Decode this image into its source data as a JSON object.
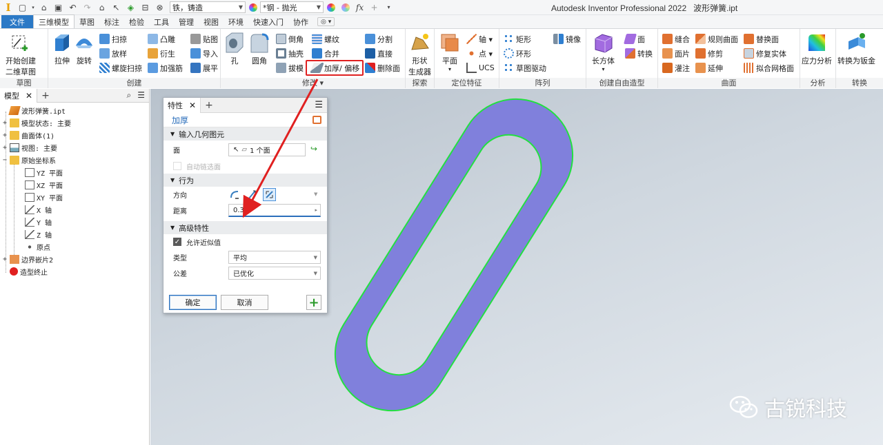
{
  "app": {
    "title": "Autodesk Inventor Professional 2022",
    "filename": "波形弹簧.ipt",
    "logo": "I",
    "material": "铁，铸造",
    "appearance": "*钢 - 抛光",
    "fx": "fx"
  },
  "tabs": [
    "文件",
    "三维模型",
    "草图",
    "标注",
    "检验",
    "工具",
    "管理",
    "视图",
    "环境",
    "快速入门",
    "协作"
  ],
  "tabs_extra": "◎ ▾",
  "ribbon": {
    "sketch_panel": {
      "label": "草图",
      "start_sketch": "开始创建",
      "start_sketch2": "二维草图"
    },
    "create_panel": {
      "label": "创建",
      "extrude": "拉伸",
      "revolve": "旋转",
      "sweep": "扫掠",
      "loft": "放样",
      "coil": "螺旋扫掠",
      "emboss": "凸雕",
      "derive": "衍生",
      "rib": "加强筋",
      "decal": "贴图",
      "import": "导入",
      "unwrap": "展平"
    },
    "modify_panel": {
      "label": "修改 ▾",
      "hole": "孔",
      "fillet": "圆角",
      "chamfer": "倒角",
      "shell": "抽壳",
      "draft": "拔模",
      "thread": "螺纹",
      "combine": "合并",
      "thicken": "加厚/ 偏移",
      "split": "分割",
      "direct": "直接",
      "delete_face": "删除面"
    },
    "explore_panel": {
      "label": "探索",
      "shape_gen": "形状",
      "shape_gen2": "生成器"
    },
    "workfeat_panel": {
      "label": "定位特征",
      "plane": "平面",
      "axis": "轴 ▾",
      "point": "点 ▾",
      "ucs": "UCS"
    },
    "pattern_panel": {
      "label": "阵列",
      "rect": "矩形",
      "circ": "环形",
      "sketch_driven": "草图驱动",
      "mirror": "镜像"
    },
    "freeform_panel": {
      "label": "创建自由造型",
      "box": "长方体",
      "face": "面",
      "convert": "转换"
    },
    "surface_panel": {
      "label": "曲面",
      "stitch": "缝合",
      "patch": "面片",
      "sculpt": "灌注",
      "ruled": "规则曲面",
      "trim": "修剪",
      "extend": "延伸",
      "replace": "替换面",
      "repair": "修复实体",
      "fit_mesh": "拟合网格面"
    },
    "analysis_panel": {
      "label": "分析",
      "stress": "应力分析"
    },
    "convert_panel": {
      "label": "转换",
      "to_sheet": "转换为钣金"
    }
  },
  "browser": {
    "tab": "模型",
    "nodes": [
      {
        "label": "波形弹簧.ipt",
        "level": 0,
        "toggle": "",
        "icon": "part-icon"
      },
      {
        "label": "模型状态: 主要",
        "level": 0,
        "toggle": "+",
        "icon": "folder-icon"
      },
      {
        "label": "曲面体(1)",
        "level": 0,
        "toggle": "+",
        "icon": "folder-icon"
      },
      {
        "label": "视图: 主要",
        "level": 0,
        "toggle": "+",
        "icon": "view-icon"
      },
      {
        "label": "原始坐标系",
        "level": 0,
        "toggle": "−",
        "icon": "folder-icon"
      },
      {
        "label": "YZ 平面",
        "level": 1,
        "toggle": "",
        "icon": "plane-icon"
      },
      {
        "label": "XZ 平面",
        "level": 1,
        "toggle": "",
        "icon": "plane-icon"
      },
      {
        "label": "XY 平面",
        "level": 1,
        "toggle": "",
        "icon": "plane-icon"
      },
      {
        "label": "X 轴",
        "level": 1,
        "toggle": "",
        "icon": "axis-icon"
      },
      {
        "label": "Y 轴",
        "level": 1,
        "toggle": "",
        "icon": "axis-icon"
      },
      {
        "label": "Z 轴",
        "level": 1,
        "toggle": "",
        "icon": "axis-icon"
      },
      {
        "label": "原点",
        "level": 1,
        "toggle": "",
        "icon": "origin-icon"
      },
      {
        "label": "边界嵌片2",
        "level": 0,
        "toggle": "+",
        "icon": "patch-icon"
      },
      {
        "label": "造型终止",
        "level": 0,
        "toggle": "",
        "icon": "end-icon"
      }
    ]
  },
  "dialog": {
    "tab": "特性",
    "title": "加厚",
    "input_geom_section": "输入几何图元",
    "face_label": "面",
    "face_value": "1 个面",
    "auto_chain": "自动链选面",
    "behavior_section": "行为",
    "direction_label": "方向",
    "distance_label": "距离",
    "distance_value": "0.3",
    "advanced_section": "高级特性",
    "allow_approx": "允许近似值",
    "type_label": "类型",
    "type_value": "平均",
    "tolerance_label": "公差",
    "tolerance_value": "已优化",
    "ok": "确定",
    "cancel": "取消",
    "add": "+"
  },
  "watermark": "古锐科技",
  "colors": {
    "file_tab": "#2b79c6",
    "part_face": "#8080dc",
    "part_edge": "#22e040",
    "highlight": "#e02020",
    "link": "#2a6ebb"
  }
}
